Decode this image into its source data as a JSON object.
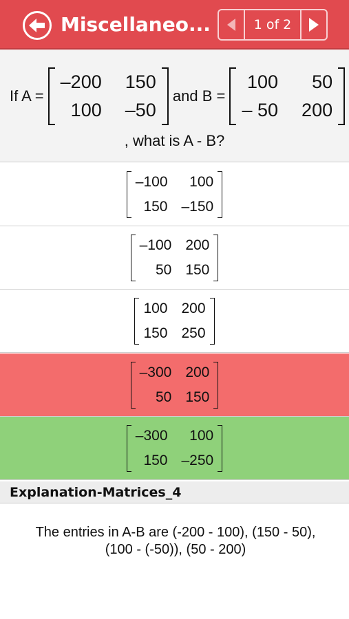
{
  "header": {
    "title": "Miscellaneo...",
    "pager_label": "1 of 2",
    "back_icon": "back-arrow-icon",
    "prev_icon": "triangle-left-icon",
    "next_icon": "triangle-right-icon",
    "color": "#e14a4f"
  },
  "question": {
    "prefix": "If A = ",
    "matrix_a": [
      "–200",
      "150",
      "100",
      "–50"
    ],
    "middle": " and B = ",
    "matrix_b": [
      "100",
      "50",
      "– 50",
      "200"
    ],
    "suffix": ", what is A - B?"
  },
  "options": [
    {
      "cells": [
        "–100",
        "100",
        "150",
        "–150"
      ],
      "state": "none"
    },
    {
      "cells": [
        "–100",
        "200",
        "50",
        "150"
      ],
      "state": "none"
    },
    {
      "cells": [
        "100",
        "200",
        "150",
        "250"
      ],
      "state": "none"
    },
    {
      "cells": [
        "–300",
        "200",
        "50",
        "150"
      ],
      "state": "wrong",
      "color": "#f36c6c"
    },
    {
      "cells": [
        "–300",
        "100",
        "150",
        "–250"
      ],
      "state": "correct",
      "color": "#8fd17a"
    }
  ],
  "explanation": {
    "title": "Explanation-Matrices_4",
    "text": "The entries in A-B are (-200 - 100), (150 - 50), (100 - (-50)), (50 - 200)"
  }
}
